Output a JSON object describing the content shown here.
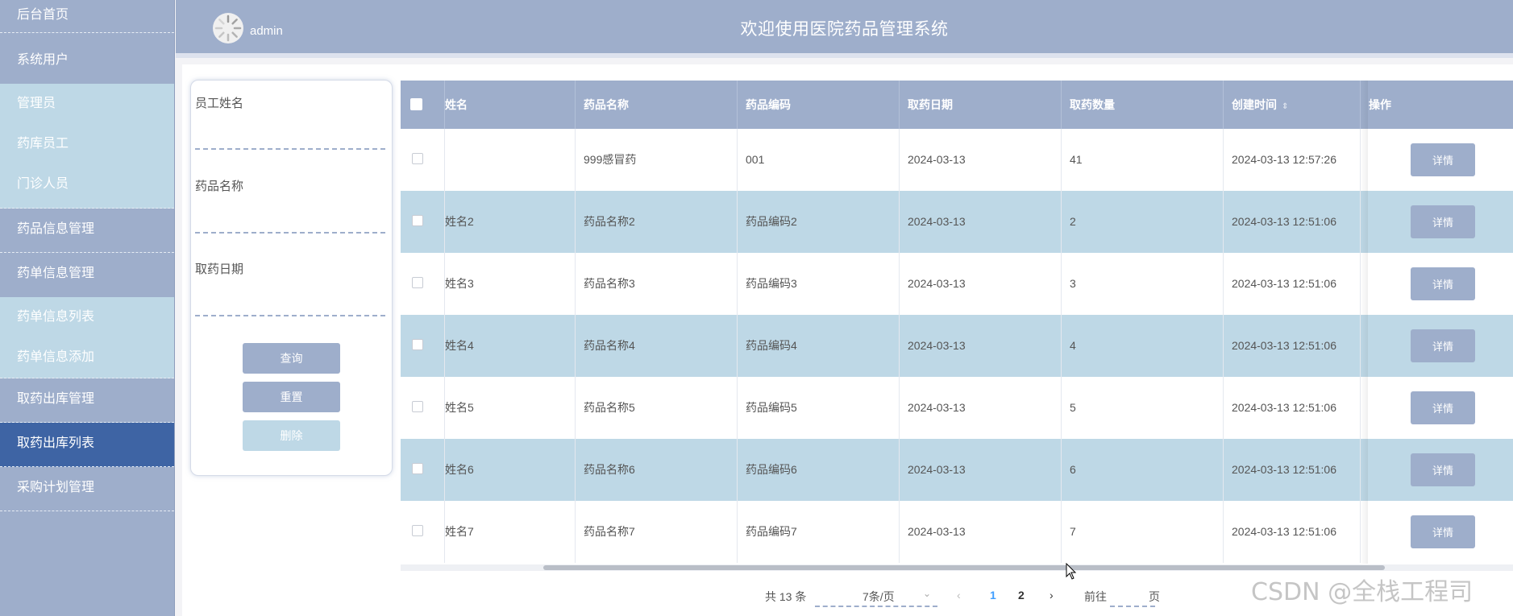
{
  "sidebar": {
    "items": [
      {
        "label": "后台首页"
      },
      {
        "label": "系统用户"
      },
      {
        "label": "药品信息管理"
      },
      {
        "label": "药单信息管理"
      },
      {
        "label": "取药出库管理"
      },
      {
        "label": "取药出库列表"
      },
      {
        "label": "采购计划管理"
      }
    ],
    "sub_users": [
      "管理员",
      "药库员工",
      "门诊人员"
    ],
    "sub_orders": [
      "药单信息列表",
      "药单信息添加"
    ]
  },
  "header": {
    "username": "admin",
    "title": "欢迎使用医院药品管理系统"
  },
  "search": {
    "employee_label": "员工姓名",
    "drug_label": "药品名称",
    "date_label": "取药日期",
    "query_label": "查询",
    "reset_label": "重置",
    "delete_label": "删除"
  },
  "table": {
    "columns": {
      "employee": "姓名",
      "drug_name": "药品名称",
      "drug_code": "药品编码",
      "date": "取药日期",
      "qty": "取药数量",
      "created": "创建时间",
      "action": "操作"
    },
    "rows": [
      {
        "employee": "",
        "drug_name": "999感冒药",
        "drug_code": "001",
        "date": "2024-03-13",
        "qty": "41",
        "created": "2024-03-13 12:57:26"
      },
      {
        "employee": "姓名2",
        "drug_name": "药品名称2",
        "drug_code": "药品编码2",
        "date": "2024-03-13",
        "qty": "2",
        "created": "2024-03-13 12:51:06"
      },
      {
        "employee": "姓名3",
        "drug_name": "药品名称3",
        "drug_code": "药品编码3",
        "date": "2024-03-13",
        "qty": "3",
        "created": "2024-03-13 12:51:06"
      },
      {
        "employee": "姓名4",
        "drug_name": "药品名称4",
        "drug_code": "药品编码4",
        "date": "2024-03-13",
        "qty": "4",
        "created": "2024-03-13 12:51:06"
      },
      {
        "employee": "姓名5",
        "drug_name": "药品名称5",
        "drug_code": "药品编码5",
        "date": "2024-03-13",
        "qty": "5",
        "created": "2024-03-13 12:51:06"
      },
      {
        "employee": "姓名6",
        "drug_name": "药品名称6",
        "drug_code": "药品编码6",
        "date": "2024-03-13",
        "qty": "6",
        "created": "2024-03-13 12:51:06"
      },
      {
        "employee": "姓名7",
        "drug_name": "药品名称7",
        "drug_code": "药品编码7",
        "date": "2024-03-13",
        "qty": "7",
        "created": "2024-03-13 12:51:06"
      }
    ],
    "detail_label": "详情"
  },
  "pagination": {
    "total": "共 13 条",
    "page_size": "7条/页",
    "pages": [
      "1",
      "2"
    ],
    "current_page": "1",
    "goto_label": "前往",
    "page_suffix": "页"
  },
  "watermark": "CSDN @全栈工程司",
  "colors": {
    "primary": "#9eaecb",
    "alt_row": "#bed8e6",
    "active_menu": "#3e64a4",
    "page_active": "#409eff"
  }
}
